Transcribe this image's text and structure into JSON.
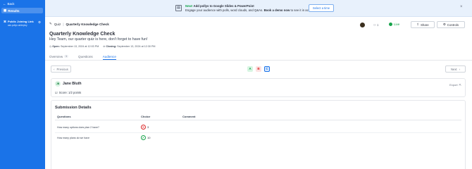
{
  "sidebar": {
    "back_label": "Back",
    "results_label": "Results",
    "join_link": {
      "title": "Public Joining Link",
      "url": "ask.pollyx.ai/deploy"
    }
  },
  "banner": {
    "new_label": "New!",
    "headline": "Add pollys to Google Slides & PowerPoint",
    "body_prefix": "Engage your audience with polls, word clouds, and Q&As.",
    "body_bold": "Book a demo now",
    "body_suffix": "to see it in action.",
    "cta_label": "Select a time",
    "close_glyph": "×"
  },
  "header": {
    "crumb_type": "Quiz",
    "crumb_sep": "|",
    "crumb_title": "Quarterly Knowledge Check",
    "title": "Quarterly Knowledge Check",
    "subtitle": "Hey Team, our quarter quiz is here, don't forget to have fun!",
    "opened_label": "Open:",
    "opened_value": "September 13, 2024 at 12:03 PM",
    "closing_label": "Closing:",
    "closing_value": "September 13, 2024 at 12:30 PM",
    "participants": "1",
    "status": "Live",
    "share_label": "Share",
    "controls_label": "Controls"
  },
  "tabs": [
    {
      "label": "Overview",
      "count": "1"
    },
    {
      "label": "Questions",
      "count": ""
    },
    {
      "label": "Audience",
      "count": ""
    }
  ],
  "pager": {
    "prev_label": "Previous",
    "next_label": "Next",
    "thumbs": [
      "A",
      "B",
      "C"
    ]
  },
  "respondent": {
    "initials": "JB",
    "name": "Jane Bluth",
    "score": "Score: 1/2 points",
    "export_label": "Export"
  },
  "details": {
    "title": "Submission Details",
    "columns": [
      "Questions",
      "Choice",
      "Comment"
    ],
    "rows": [
      {
        "question": "How many options does plan 2 have?",
        "choice": "3",
        "correct": false
      },
      {
        "question": "How many plans do we have",
        "choice": "10",
        "correct": true
      }
    ]
  },
  "colors": {
    "accent": "#1a73e8",
    "success": "#16a34a",
    "danger": "#dc2626"
  }
}
